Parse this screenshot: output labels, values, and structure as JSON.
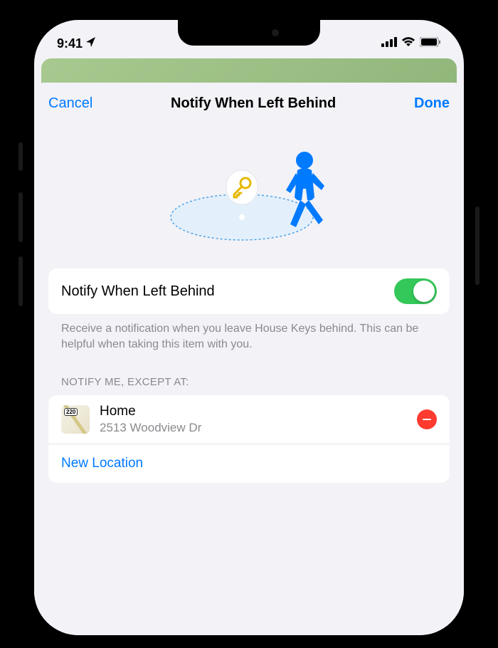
{
  "status": {
    "time": "9:41"
  },
  "modal": {
    "cancel": "Cancel",
    "done": "Done",
    "title": "Notify When Left Behind"
  },
  "toggle": {
    "label": "Notify When Left Behind",
    "on": true
  },
  "description": "Receive a notification when you leave House Keys behind. This can be helpful when taking this item with you.",
  "exceptions": {
    "header": "NOTIFY ME, EXCEPT AT:",
    "location": {
      "name": "Home",
      "address": "2513 Woodview Dr",
      "route_badge": "220"
    },
    "new_location": "New Location"
  }
}
